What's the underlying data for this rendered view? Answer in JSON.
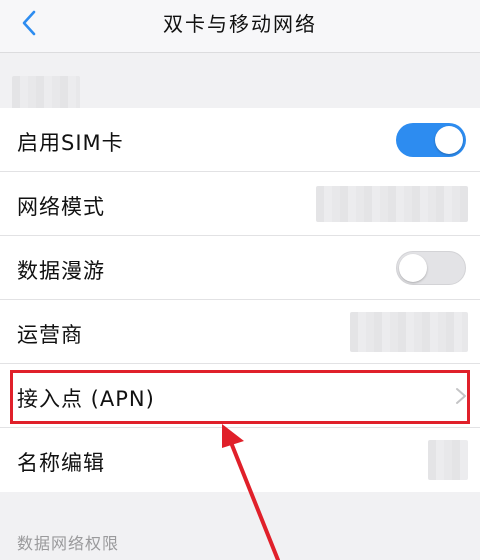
{
  "header": {
    "title": "双卡与移动网络",
    "back_icon": "chevron-left-icon"
  },
  "rows": [
    {
      "label": "启用SIM卡",
      "control": "toggle",
      "toggle_on": true
    },
    {
      "label": "网络模式",
      "control": "value-redacted"
    },
    {
      "label": "数据漫游",
      "control": "toggle",
      "toggle_on": false
    },
    {
      "label": "运营商",
      "control": "value-redacted"
    },
    {
      "label": "接入点 (APN)",
      "control": "chevron",
      "highlighted": true
    },
    {
      "label": "名称编辑",
      "control": "value-redacted"
    }
  ],
  "section": {
    "label": "数据网络权限"
  },
  "colors": {
    "accent": "#2d8cf0",
    "annotation_red": "#e0202a",
    "background": "#f1f1f3"
  }
}
